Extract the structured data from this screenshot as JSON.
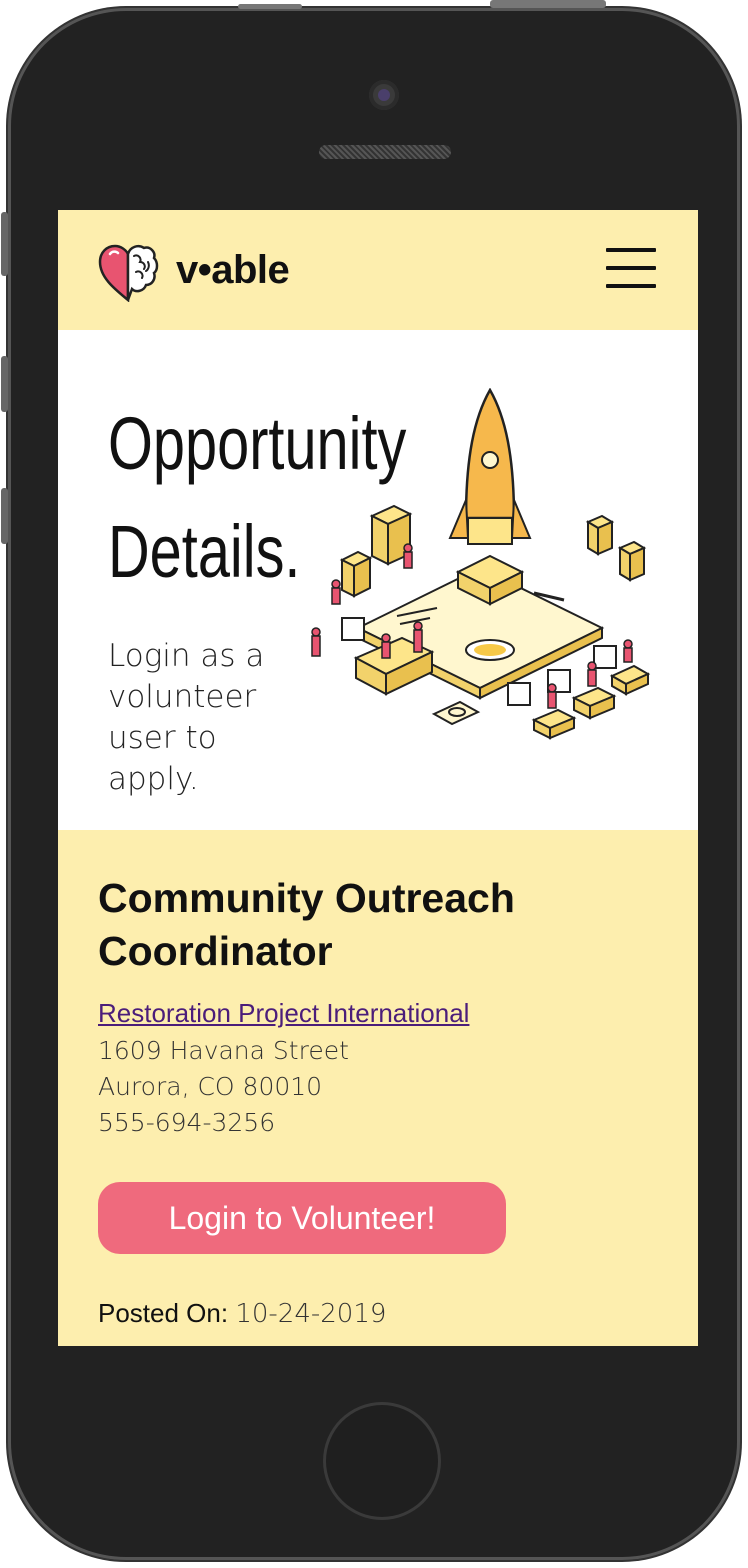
{
  "app": {
    "brand": "v•able"
  },
  "nav": {
    "menu_icon": "hamburger-menu-icon"
  },
  "hero": {
    "title": "Opportunity\nDetails.",
    "subtitle": "Login as a volunteer user to apply.",
    "illustration_icon": "rocket-launch-illustration"
  },
  "opportunity": {
    "title": "Community Outreach Coordinator",
    "organization": "Restoration Project International",
    "street": "1609 Havana Street",
    "city_state_zip": "Aurora, CO 80010",
    "phone": "555-694-3256",
    "cta_label": "Login to Volunteer!",
    "posted_label": "Posted On:",
    "posted_date": "10-24-2019"
  },
  "colors": {
    "navbar_bg": "#fdeeae",
    "details_bg": "#fdeeae",
    "cta_bg": "#ef6a7d",
    "link": "#4b1d7a",
    "phone_body": "#222222"
  }
}
